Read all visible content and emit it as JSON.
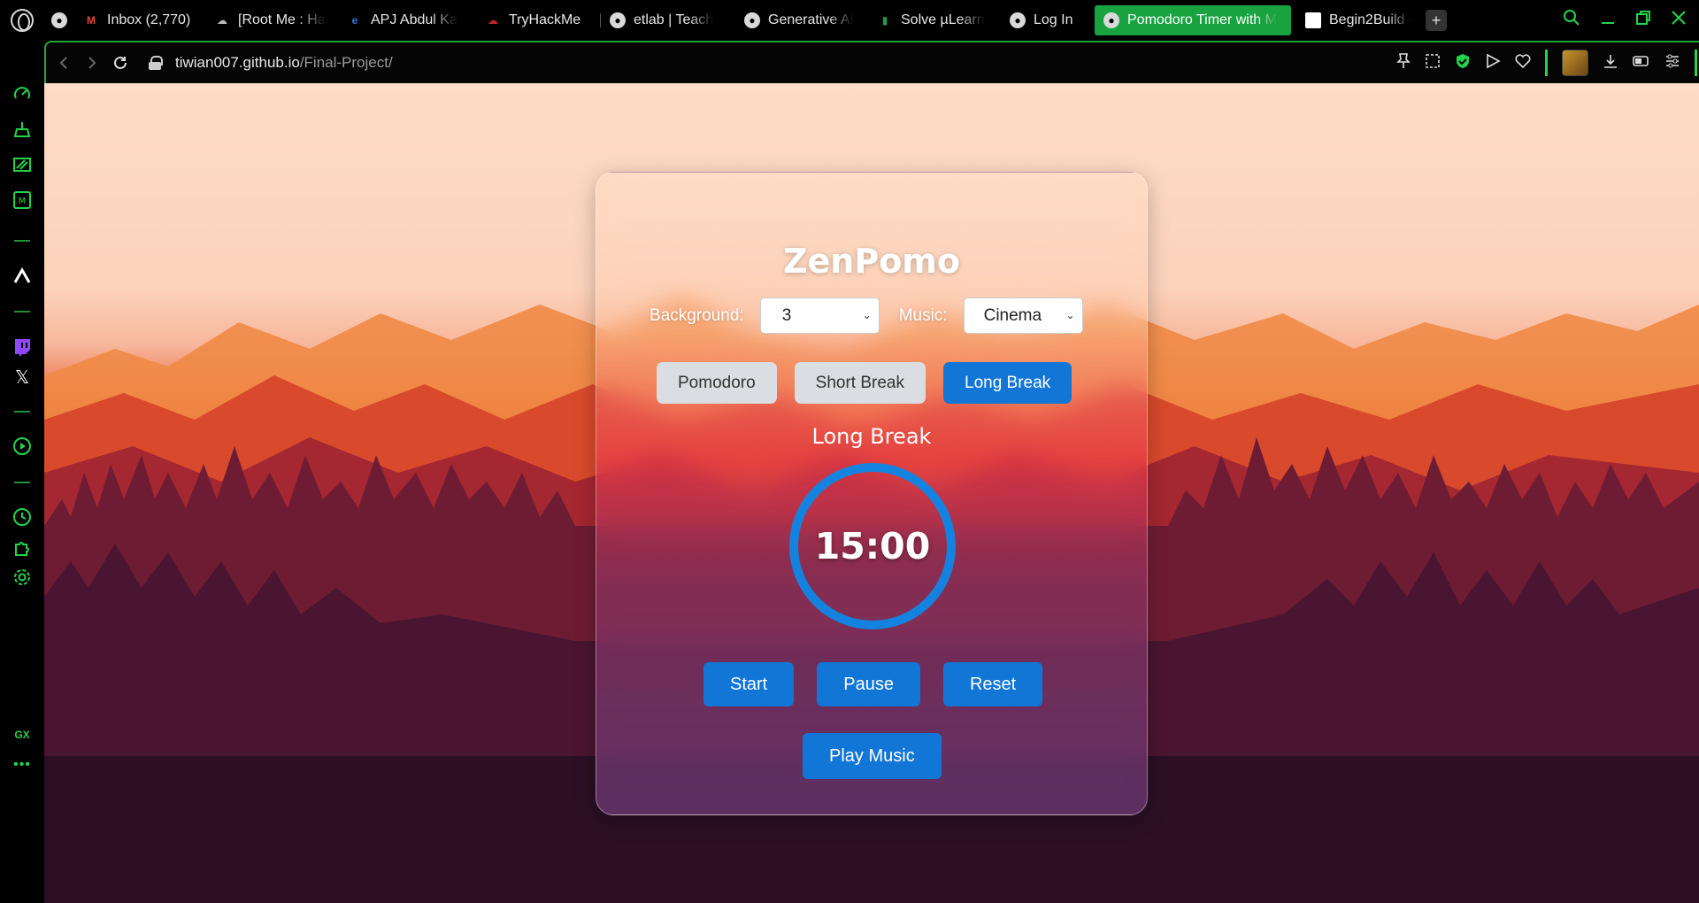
{
  "browser": {
    "tabs": [
      {
        "label": "Inbox (2,770)",
        "icon": "gmail-icon",
        "icon_glyph": "M",
        "icon_color": "#ea4335",
        "fade": false
      },
      {
        "label": "[Root Me : Ha",
        "icon": "rootme-icon",
        "icon_glyph": "☁",
        "icon_color": "#bbbbbb",
        "fade": true
      },
      {
        "label": "APJ Abdul Ka",
        "icon": "edge-icon",
        "icon_glyph": "e",
        "icon_color": "#2d7be5",
        "fade": true
      },
      {
        "label": "TryHackMe",
        "icon": "tryhackme-icon",
        "icon_glyph": "☁",
        "icon_color": "#c0262d",
        "fade": false
      },
      {
        "label": "etlab | Teach",
        "icon": "globe-icon",
        "icon_glyph": "",
        "icon_color": "#d9d9d9",
        "fade": true
      },
      {
        "label": "Generative AI",
        "icon": "globe-icon",
        "icon_glyph": "",
        "icon_color": "#d9d9d9",
        "fade": true
      },
      {
        "label": "Solve µLearn",
        "icon": "mulearn-icon",
        "icon_glyph": "▮",
        "icon_color": "#1f9a4d",
        "fade": true
      },
      {
        "label": "Log In",
        "icon": "globe-icon",
        "icon_glyph": "",
        "icon_color": "#d9d9d9",
        "fade": false
      }
    ],
    "active_tab": {
      "label": "Pomodoro Timer with M",
      "icon": "globe-icon"
    },
    "next_tab": {
      "label": "Begin2Build -",
      "icon": "page-icon"
    },
    "url_host": "tiwian007.github.io",
    "url_path": "/Final-Project/",
    "sidebar_bottom_label": "GX",
    "accent_color": "#22d34b"
  },
  "app": {
    "title": "ZenPomo",
    "background_label": "Background:",
    "background_value": "3",
    "music_label": "Music:",
    "music_value": "Cinema",
    "modes": [
      "Pomodoro",
      "Short Break",
      "Long Break"
    ],
    "active_mode": "Long Break",
    "mode_label": "Long Break",
    "time": "15:00",
    "actions": [
      "Start",
      "Pause",
      "Reset"
    ],
    "music_button": "Play Music",
    "button_color": "#1176d6"
  }
}
